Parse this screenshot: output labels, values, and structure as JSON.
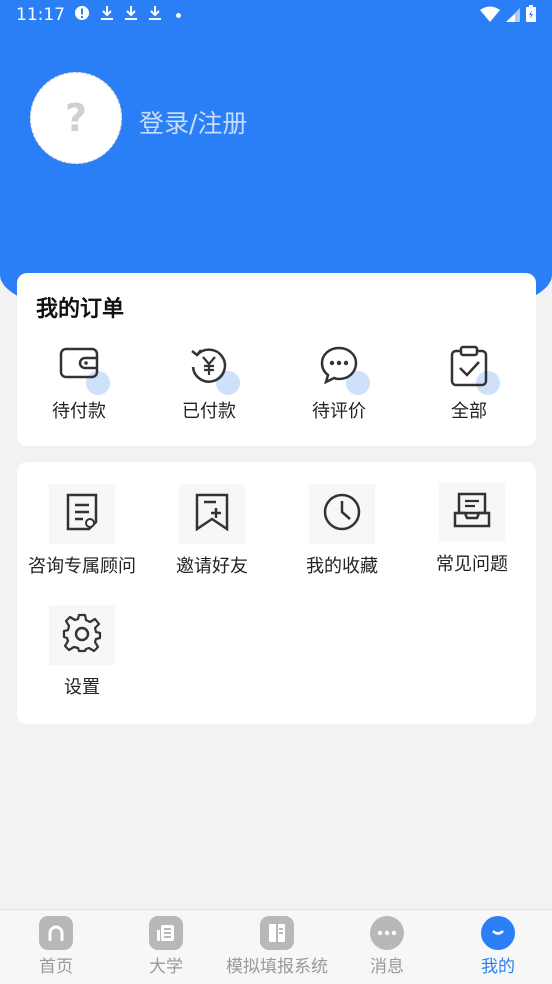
{
  "status_bar": {
    "time": "11:17"
  },
  "profile": {
    "avatar_placeholder": "?",
    "login_label": "登录/注册"
  },
  "orders": {
    "title": "我的订单",
    "items": [
      {
        "label": "待付款",
        "icon": "wallet-icon"
      },
      {
        "label": "已付款",
        "icon": "yen-refresh-icon"
      },
      {
        "label": "待评价",
        "icon": "chat-bubble-icon"
      },
      {
        "label": "全部",
        "icon": "clipboard-check-icon"
      }
    ]
  },
  "services": {
    "items": [
      {
        "label": "咨询专属顾问",
        "icon": "document-icon"
      },
      {
        "label": "邀请好友",
        "icon": "bookmark-plus-icon"
      },
      {
        "label": "我的收藏",
        "icon": "clock-icon"
      },
      {
        "label": "常见问题",
        "icon": "inbox-tray-icon"
      },
      {
        "label": "设置",
        "icon": "gear-icon"
      }
    ]
  },
  "tab_bar": {
    "tabs": [
      {
        "label": "首页",
        "icon": "home-icon",
        "active": false
      },
      {
        "label": "大学",
        "icon": "newspaper-icon",
        "active": false
      },
      {
        "label": "模拟填报系统",
        "icon": "book-icon",
        "active": false
      },
      {
        "label": "消息",
        "icon": "message-icon",
        "active": false
      },
      {
        "label": "我的",
        "icon": "profile-icon",
        "active": true
      }
    ],
    "active_color": "#2a7ff6"
  },
  "theme": {
    "primary": "#2a7ff6",
    "background": "#f2f2f2"
  }
}
